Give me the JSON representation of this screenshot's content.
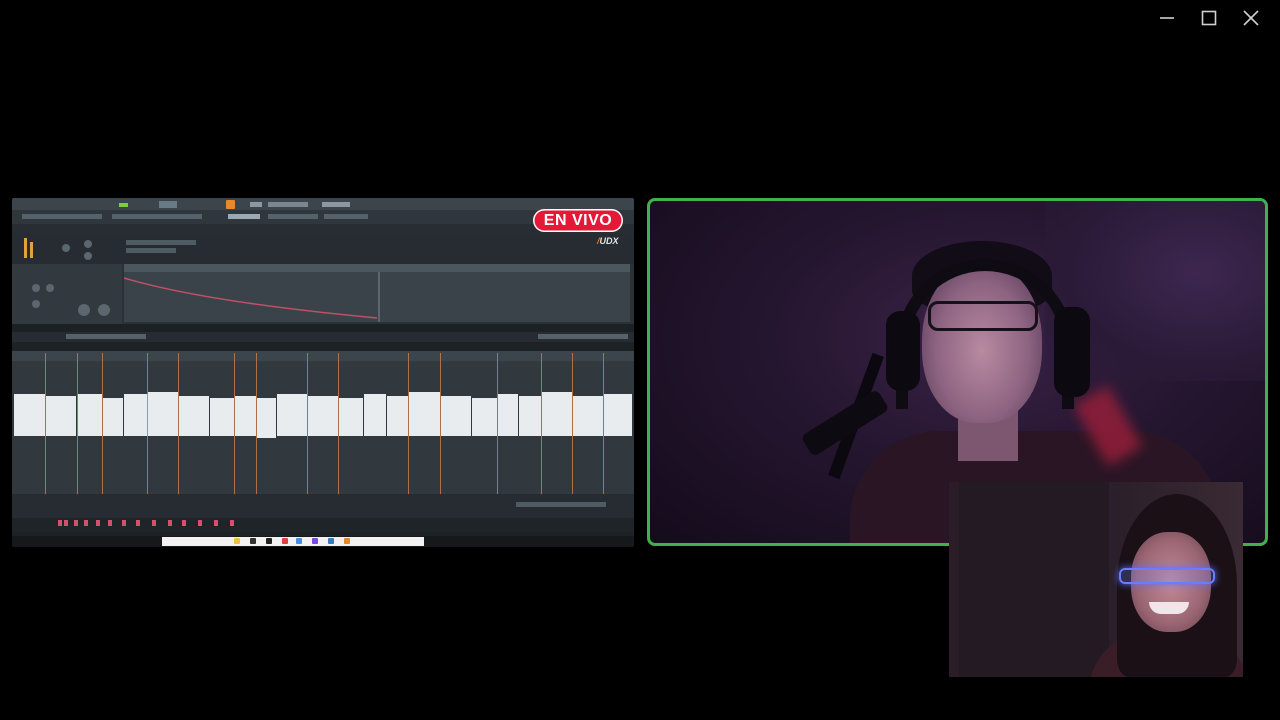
{
  "window": {
    "controls": {
      "minimize_icon": "minimize-icon",
      "maximize_icon": "maximize-icon",
      "close_icon": "close-icon"
    }
  },
  "screen_share": {
    "live_badge": "EN VIVO",
    "brand": {
      "slash": "/",
      "name": "UDX"
    }
  },
  "colors": {
    "background": "#000000",
    "active_speaker_border": "#3fb24f",
    "live_badge": "#e51937",
    "waveform": "#e8ecef",
    "clip_marker": "#c67a4a"
  },
  "participants": [
    {
      "tile": "main-camera",
      "active_speaker": true
    },
    {
      "tile": "picture-in-picture-camera",
      "active_speaker": false
    }
  ]
}
